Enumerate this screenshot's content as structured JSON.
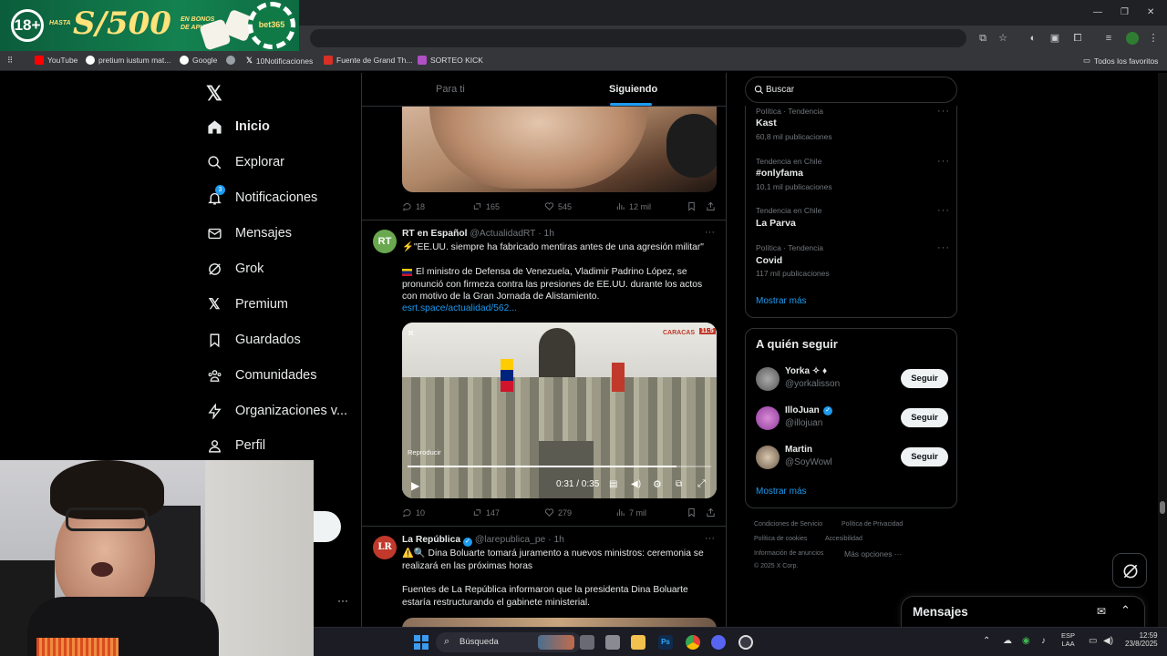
{
  "ad": {
    "age": "18+",
    "hasta": "HASTA",
    "amount": "S/500",
    "en_bonos": "EN BONOS",
    "de_apuesta": "DE APUESTA",
    "brand": "bet365"
  },
  "window": {
    "minimize": "—",
    "maximize": "❐",
    "close": "✕"
  },
  "bookmarks": [
    {
      "label": "YouTube",
      "color": "#ff0000"
    },
    {
      "label": "pretium iustum mat...",
      "color": "#ffffff"
    },
    {
      "label": "Google",
      "color": "#ffffff"
    },
    {
      "label": "",
      "color": "#9aa0a6"
    },
    {
      "label": "10Notificaciones",
      "color": "#000000"
    },
    {
      "label": "Fuente de Grand Th...",
      "color": "#d93025"
    },
    {
      "label": "SORTEO KICK",
      "color": "#b14fc5"
    }
  ],
  "bookmarks_all": "Todos los favoritos",
  "nav": {
    "items": [
      {
        "label": "Inicio",
        "icon": "home-icon"
      },
      {
        "label": "Explorar",
        "icon": "search-icon"
      },
      {
        "label": "Notificaciones",
        "icon": "bell-icon",
        "badge": "3"
      },
      {
        "label": "Mensajes",
        "icon": "mail-icon"
      },
      {
        "label": "Grok",
        "icon": "grok-icon"
      },
      {
        "label": "Premium",
        "icon": "x-icon"
      },
      {
        "label": "Guardados",
        "icon": "bookmark-icon"
      },
      {
        "label": "Comunidades",
        "icon": "people-icon"
      },
      {
        "label": "Organizaciones v...",
        "icon": "bolt-icon"
      },
      {
        "label": "Perfil",
        "icon": "person-icon"
      }
    ],
    "more": "···"
  },
  "tabs": {
    "for_you": "Para ti",
    "following": "Siguiendo"
  },
  "tweet1": {
    "replies": "18",
    "retweets": "165",
    "likes": "545",
    "views": "12 mil"
  },
  "tweet2": {
    "name": "RT en Español",
    "handle": "@ActualidadRT",
    "time": "· 1h",
    "line1": "⚡️\"EE.UU. siempre ha fabricado mentiras antes de una agresión militar\"",
    "body": "El ministro de Defensa de Venezuela, Vladimir Padrino López, se pronunció con firmeza contra las presiones de EE.UU. durante los actos con motivo de la Gran Jornada de Alistamiento.",
    "link": "esrt.space/actualidad/562...",
    "video": {
      "tooltip": "Reproducir",
      "time": "0:31 / 0:35",
      "location": "CARACAS",
      "clock": "11:5",
      "progress": 0.886
    },
    "replies": "10",
    "retweets": "147",
    "likes": "279",
    "views": "7 mil"
  },
  "tweet3": {
    "name": "La República",
    "handle": "@larepublica_pe",
    "time": "· 1h",
    "line1": "⚠️🔍 Dina Boluarte tomará juramento a nuevos ministros: ceremonia se realizará en las próximas horas",
    "body": "Fuentes de La República informaron que la presidenta Dina Boluarte estaría restructurando el gabinete ministerial."
  },
  "search": {
    "placeholder": "Buscar"
  },
  "trends": [
    {
      "meta": "Política · Tendencia",
      "name": "Kast",
      "count": "60,8 mil publicaciones"
    },
    {
      "meta": "Tendencia en Chile",
      "name": "#onlyfama",
      "count": "10,1 mil publicaciones"
    },
    {
      "meta": "Tendencia en Chile",
      "name": "La Parva",
      "count": ""
    },
    {
      "meta": "Política · Tendencia",
      "name": "Covid",
      "count": "117 mil publicaciones"
    }
  ],
  "show_more": "Mostrar más",
  "who_to_follow": {
    "title": "A quién seguir",
    "users": [
      {
        "name": "Yorka ✧ ♦",
        "handle": "@yorkalisson",
        "button": "Seguir"
      },
      {
        "name": "IlloJuan",
        "handle": "@illojuan",
        "button": "Seguir",
        "verified": true
      },
      {
        "name": "Martin",
        "handle": "@SoyWowl",
        "button": "Seguir"
      }
    ],
    "show_more": "Mostrar más"
  },
  "footer": {
    "terms": "Condiciones de Servicio",
    "privacy": "Política de Privacidad",
    "cookies": "Política de cookies",
    "accessibility": "Accesibilidad",
    "ads": "Información de anuncios",
    "more": "Más opciones ···",
    "copyright": "© 2025 X Corp."
  },
  "messages_drawer": {
    "title": "Mensajes"
  },
  "taskbar": {
    "search": "Búsqueda",
    "lang1": "ESP",
    "lang2": "LAA",
    "time": "12:59",
    "date": "23/8/2025"
  },
  "colors": {
    "accent": "#1d9bf0",
    "bg": "#000000",
    "border": "#2f3336",
    "muted": "#71767b"
  }
}
